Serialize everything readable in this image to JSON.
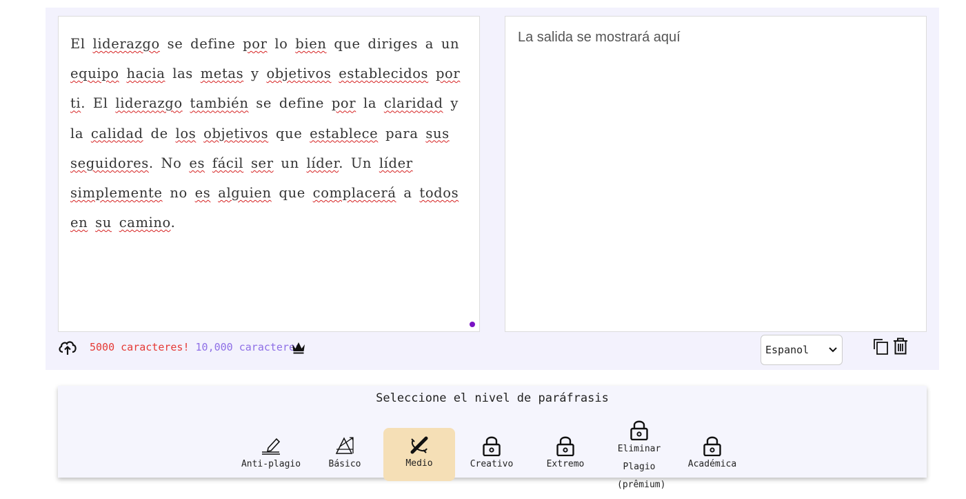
{
  "input": {
    "segments": [
      {
        "t": "El ",
        "u": false
      },
      {
        "t": "liderazgo",
        "u": true
      },
      {
        "t": " se define ",
        "u": false
      },
      {
        "t": "por",
        "u": true
      },
      {
        "t": " lo ",
        "u": false
      },
      {
        "t": "bien",
        "u": true
      },
      {
        "t": " que diriges a un ",
        "u": false
      },
      {
        "t": "equipo",
        "u": true
      },
      {
        "t": " ",
        "u": false
      },
      {
        "t": "hacia",
        "u": true
      },
      {
        "t": " las ",
        "u": false
      },
      {
        "t": "metas",
        "u": true
      },
      {
        "t": " y ",
        "u": false
      },
      {
        "t": "objetivos",
        "u": true
      },
      {
        "t": " ",
        "u": false
      },
      {
        "t": "establecidos",
        "u": true
      },
      {
        "t": " ",
        "u": false
      },
      {
        "t": "por",
        "u": true
      },
      {
        "t": " ",
        "u": false
      },
      {
        "t": "ti",
        "u": true
      },
      {
        "t": ". El ",
        "u": false
      },
      {
        "t": "liderazgo",
        "u": true
      },
      {
        "t": " ",
        "u": false
      },
      {
        "t": "también",
        "u": true
      },
      {
        "t": " se define ",
        "u": false
      },
      {
        "t": "por",
        "u": true
      },
      {
        "t": " la ",
        "u": false
      },
      {
        "t": "claridad",
        "u": true
      },
      {
        "t": " y la ",
        "u": false
      },
      {
        "t": "calidad",
        "u": true
      },
      {
        "t": " de ",
        "u": false
      },
      {
        "t": "los",
        "u": true
      },
      {
        "t": " ",
        "u": false
      },
      {
        "t": "objetivos",
        "u": true
      },
      {
        "t": " que ",
        "u": false
      },
      {
        "t": "establece",
        "u": true
      },
      {
        "t": " para ",
        "u": false
      },
      {
        "t": "sus",
        "u": true
      },
      {
        "t": " ",
        "u": false
      },
      {
        "t": "seguidores",
        "u": true
      },
      {
        "t": ". No ",
        "u": false
      },
      {
        "t": "es",
        "u": true
      },
      {
        "t": " ",
        "u": false
      },
      {
        "t": "fácil",
        "u": true
      },
      {
        "t": " ",
        "u": false
      },
      {
        "t": "ser",
        "u": true
      },
      {
        "t": " un ",
        "u": false
      },
      {
        "t": "líder",
        "u": true
      },
      {
        "t": ". Un ",
        "u": false
      },
      {
        "t": "líder",
        "u": true
      },
      {
        "t": " ",
        "u": false
      },
      {
        "t": "simplemente",
        "u": true
      },
      {
        "t": " no ",
        "u": false
      },
      {
        "t": "es",
        "u": true
      },
      {
        "t": " ",
        "u": false
      },
      {
        "t": "alguien",
        "u": true
      },
      {
        "t": " que ",
        "u": false
      },
      {
        "t": "complacerá",
        "u": true
      },
      {
        "t": " a ",
        "u": false
      },
      {
        "t": "todos",
        "u": true
      },
      {
        "t": " ",
        "u": false
      },
      {
        "t": "en",
        "u": true
      },
      {
        "t": " ",
        "u": false
      },
      {
        "t": "su",
        "u": true
      },
      {
        "t": " ",
        "u": false
      },
      {
        "t": "camino",
        "u": true
      },
      {
        "t": ".",
        "u": false
      }
    ]
  },
  "output": {
    "placeholder": "La salida se mostrará aquí"
  },
  "footer": {
    "chars_free": "5000 caracteres!",
    "chars_premium": "10,000 caracteres",
    "language": "Espanol",
    "colors": {
      "free": "#e53935",
      "premium": "#8e6fe6"
    }
  },
  "levels": {
    "title": "Seleccione el nivel de paráfrasis",
    "items": [
      {
        "label": "Anti-plagio",
        "icon": "pen-icon",
        "locked": false,
        "selected": false
      },
      {
        "label": "Básico",
        "icon": "geometry-icon",
        "locked": false,
        "selected": false
      },
      {
        "label": "Medio",
        "icon": "wand-icon",
        "locked": false,
        "selected": true
      },
      {
        "label": "Creativo",
        "icon": "lock-icon",
        "locked": true,
        "selected": false
      },
      {
        "label": "Extremo",
        "icon": "lock-icon",
        "locked": true,
        "selected": false
      },
      {
        "label": "Eliminar Plagio (prêmium)",
        "icon": "lock-icon",
        "locked": true,
        "selected": false
      },
      {
        "label": "Académica",
        "icon": "lock-icon",
        "locked": true,
        "selected": false
      }
    ],
    "selected_color": "#f5dfb6"
  }
}
